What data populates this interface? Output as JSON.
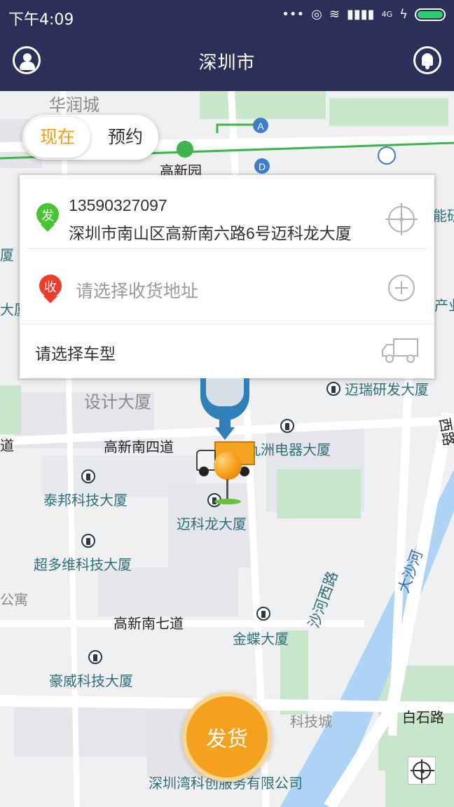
{
  "status_bar": {
    "time": "下午4:09",
    "icons": [
      "more-dots-icon",
      "alarm-icon",
      "wifi-icon",
      "signal-icon",
      "battery-icon"
    ],
    "network": "4G"
  },
  "header": {
    "title": "深圳市",
    "left_icon": "user-icon",
    "right_icon": "bell-icon"
  },
  "mode_toggle": {
    "now": "现在",
    "reserve": "预约",
    "active_color": "#f39c12"
  },
  "address_card": {
    "sender": {
      "badge": "发",
      "phone": "13590327097",
      "address": "深圳市南山区高新南六路6号迈科龙大厦"
    },
    "receiver": {
      "badge": "收",
      "placeholder": "请选择收货地址"
    },
    "vehicle": {
      "placeholder": "请选择车型"
    }
  },
  "map": {
    "labels": {
      "huarun": "华润城",
      "gaoxinyuan": "高新园",
      "design": "设计大厦",
      "road4": "高新南四道",
      "road7": "高新南七道",
      "maruisoft": "迈瑞研发大厦",
      "jiuzhou": "九洲电器大厦",
      "taibang": "泰邦科技大厦",
      "maikelong": "迈科龙大厦",
      "chaoduowei": "超多维科技大厦",
      "kingdee": "金蝶大厦",
      "haowei": "豪威科技大厦",
      "shaherd": "沙河西路",
      "dashahe": "大沙河",
      "baishi": "白石路",
      "kejicheng": "科技城",
      "company": "深圳湾科创服务有限公司",
      "edge_xia1": "厦",
      "edge_xia2": "大厦",
      "edge_dao": "道",
      "edge_gongyu": "公寓",
      "edge_yan": "能研",
      "edge_chan": "产业",
      "edge_road": "西路"
    },
    "metro_markers": [
      "A",
      "D"
    ],
    "colors": {
      "water": "#aed4f5",
      "green": "#c8e6c9",
      "road": "#ffffff",
      "metro_line": "#3cb44b"
    }
  },
  "actions": {
    "ship_button": "发货",
    "ship_color": "#f4a21e"
  }
}
